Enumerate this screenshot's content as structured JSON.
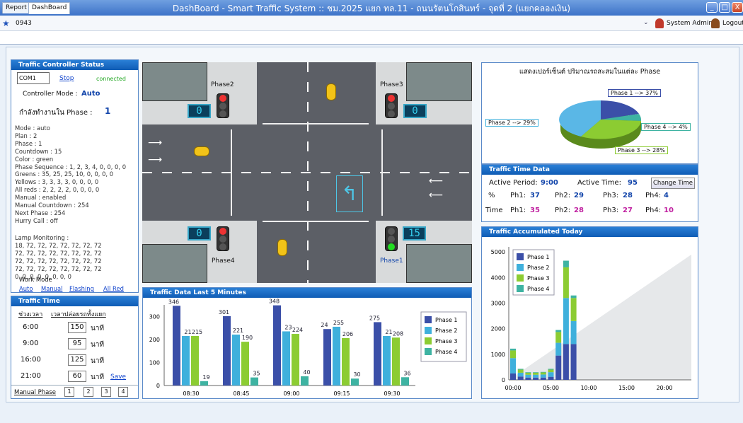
{
  "window": {
    "title": "DashBoard - Smart Traffic System :: ชม.2025 แยก ทล.11 - ถนนรัตนโกสินทร์ - จุดที่ 2 (แยกคลองเงิน)",
    "min": "_",
    "max": "□",
    "close": "X"
  },
  "toolbar": {
    "code": "0943",
    "user": "System Admin",
    "logout": "Logout"
  },
  "tabs": [
    {
      "label": "Report"
    },
    {
      "label": "DashBoard"
    }
  ],
  "controller": {
    "header": "Traffic Controller Status",
    "port": "COM1",
    "stop": "Stop",
    "status": "connected",
    "mode_label": "Controller Mode :",
    "mode_value": "Auto",
    "phase_label": "กำลังทำงานใน Phase :",
    "phase_value": "1",
    "lines": [
      "Mode : auto",
      "Plan : 2",
      "Phase : 1",
      "Countdown : 15",
      "Color : green",
      "Phase Sequence : 1, 2, 3, 4, 0, 0, 0, 0",
      "Greens : 35, 25, 25, 10, 0, 0, 0, 0",
      "Yellows : 3, 3, 3, 3, 0, 0, 0, 0",
      "All reds : 2, 2, 2, 2, 0, 0, 0, 0",
      "Manual : enabled",
      "Manual Countdown : 254",
      "Next Phase : 254",
      "Hurry Call : off"
    ],
    "lamp_label": "Lamp Monitoring :",
    "lamp_lines": [
      "18, 72, 72, 72, 72, 72, 72, 72",
      "72, 72, 72, 72, 72, 72, 72, 72",
      "72, 72, 72, 72, 72, 72, 72, 72",
      "72, 72, 72, 72, 72, 72, 72, 72",
      "0, 0, 0, 0, 0, 0, 0, 0"
    ],
    "work_mode": "Work Mode",
    "modes": [
      "Auto",
      "Manual",
      "Flashing",
      "All Red"
    ]
  },
  "traffic_time": {
    "header": "Traffic Time",
    "col1": "ช่วงเวลา",
    "col2": "เวลาปล่อยรถทั้งแยก",
    "unit": "นาที",
    "save": "Save",
    "rows": [
      {
        "time": "6:00",
        "value": "150"
      },
      {
        "time": "9:00",
        "value": "95"
      },
      {
        "time": "16:00",
        "value": "125"
      },
      {
        "time": "21:00",
        "value": "60"
      }
    ],
    "manual_phase": "Manual Phase",
    "phase_buttons": [
      "1",
      "2",
      "3",
      "4"
    ]
  },
  "intersection": {
    "phase2": "Phase2",
    "phase3": "Phase3",
    "phase4": "Phase4",
    "phase1": "Phase1",
    "cnt_p2": "0",
    "cnt_p3": "0",
    "cnt_p4": "0",
    "cnt_p1": "15"
  },
  "pie": {
    "title": "แสดงเปอร์เซ็นต์ ปริมาณรถสะสมในแต่ละ Phase",
    "labels": [
      "Phase 1 --> 37%",
      "Phase 2 --> 29%",
      "Phase 4 --> 4%",
      "Phase 3 --> 28%"
    ]
  },
  "time_data": {
    "header": "Traffic Time Data",
    "active_period_label": "Active Period:",
    "active_period": "9:00",
    "active_time_label": "Active Time:",
    "active_time": "95",
    "change_time": "Change Time",
    "pct_label": "%",
    "time_label": "Time",
    "ph_labels": [
      "Ph1:",
      "Ph2:",
      "Ph3:",
      "Ph4:"
    ],
    "pct": [
      "37",
      "29",
      "28",
      "4"
    ],
    "time": [
      "35",
      "28",
      "27",
      "10"
    ]
  },
  "colors": {
    "phase1": "#3b4fa8",
    "phase2": "#3fb0dc",
    "phase3": "#8ccc32",
    "phase4": "#3eb3a2",
    "header": "#1467c4"
  },
  "chart_data": [
    {
      "type": "bar",
      "title": "Traffic Data Last 5 Minutes",
      "categories": [
        "08:30",
        "08:45",
        "09:00",
        "09:15",
        "09:30"
      ],
      "ylim": [
        0,
        350
      ],
      "yticks": [
        "0",
        "100",
        "200",
        "300"
      ],
      "series": [
        {
          "name": "Phase 1",
          "values": [
            346,
            301,
            348,
            245,
            275
          ]
        },
        {
          "name": "Phase 2",
          "values": [
            215,
            221,
            235,
            255,
            215
          ]
        },
        {
          "name": "Phase 3",
          "values": [
            215,
            190,
            224,
            206,
            208
          ]
        },
        {
          "name": "Phase 4",
          "values": [
            19,
            35,
            40,
            30,
            36
          ]
        }
      ],
      "value_labels": [
        [
          "346",
          "21",
          "215",
          "19"
        ],
        [
          "301",
          "221",
          "190",
          "35"
        ],
        [
          "348",
          "23",
          "224",
          "40"
        ],
        [
          "24",
          "255",
          "206",
          "30"
        ],
        [
          "275",
          "21",
          "208",
          "36"
        ]
      ]
    },
    {
      "type": "bar",
      "title": "Traffic Accumulated Today",
      "stacked": true,
      "x_ticks": [
        "00:00",
        "05:00",
        "10:00",
        "15:00",
        "20:00"
      ],
      "yticks": [
        "0",
        "1000",
        "2000",
        "3000",
        "4000",
        "5000"
      ],
      "ylim": [
        0,
        5200
      ],
      "x_hours": [
        0,
        1,
        2,
        3,
        4,
        5,
        6,
        7,
        8
      ],
      "series": [
        {
          "name": "Phase 1",
          "values": [
            250,
            130,
            90,
            90,
            90,
            120,
            950,
            1400,
            1400
          ]
        },
        {
          "name": "Phase 2",
          "values": [
            600,
            150,
            110,
            110,
            120,
            180,
            500,
            1800,
            900
          ]
        },
        {
          "name": "Phase 3",
          "values": [
            300,
            120,
            80,
            80,
            80,
            100,
            420,
            1200,
            900
          ]
        },
        {
          "name": "Phase 4",
          "values": [
            70,
            30,
            20,
            20,
            20,
            30,
            80,
            260,
            100
          ]
        }
      ]
    }
  ]
}
